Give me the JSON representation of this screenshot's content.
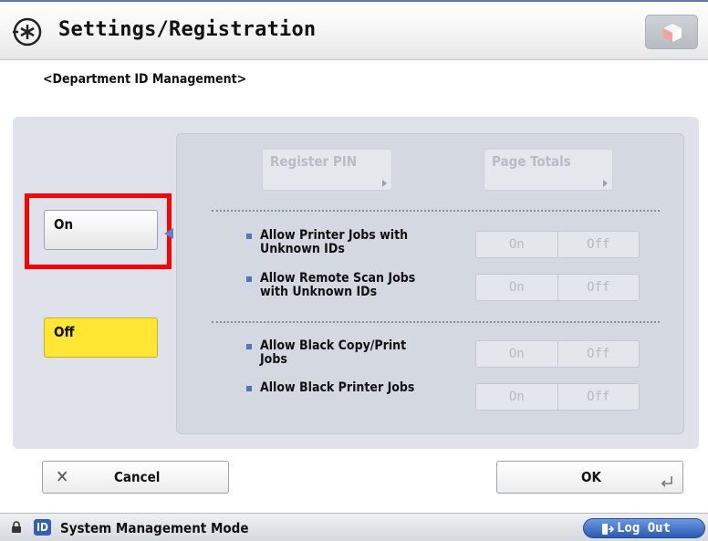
{
  "header": {
    "title": "Settings/Registration",
    "icon": "settings-asterisk-icon",
    "right_button_icon": "cube-icon"
  },
  "subtitle": "<Department ID Management>",
  "mode_buttons": {
    "on_label": "On",
    "off_label": "Off",
    "selected": "Off",
    "highlight_color": "#ff0000",
    "selected_color": "#ffe733"
  },
  "actions": {
    "register_pin": "Register PIN",
    "page_totals": "Page Totals"
  },
  "options": [
    {
      "line1": "Allow Printer Jobs with",
      "line2": "Unknown IDs",
      "on": "On",
      "off": "Off"
    },
    {
      "line1": "Allow Remote Scan Jobs",
      "line2": "with Unknown IDs",
      "on": "On",
      "off": "Off"
    },
    {
      "line1": "Allow Black Copy/Print",
      "line2": "Jobs",
      "on": "On",
      "off": "Off"
    },
    {
      "line1": "Allow Black Printer Jobs",
      "line2": "",
      "on": "On",
      "off": "Off"
    }
  ],
  "footer": {
    "cancel": "Cancel",
    "ok": "OK"
  },
  "status": {
    "badge": "ID",
    "mode": "System Management Mode",
    "logout": "Log Out"
  }
}
